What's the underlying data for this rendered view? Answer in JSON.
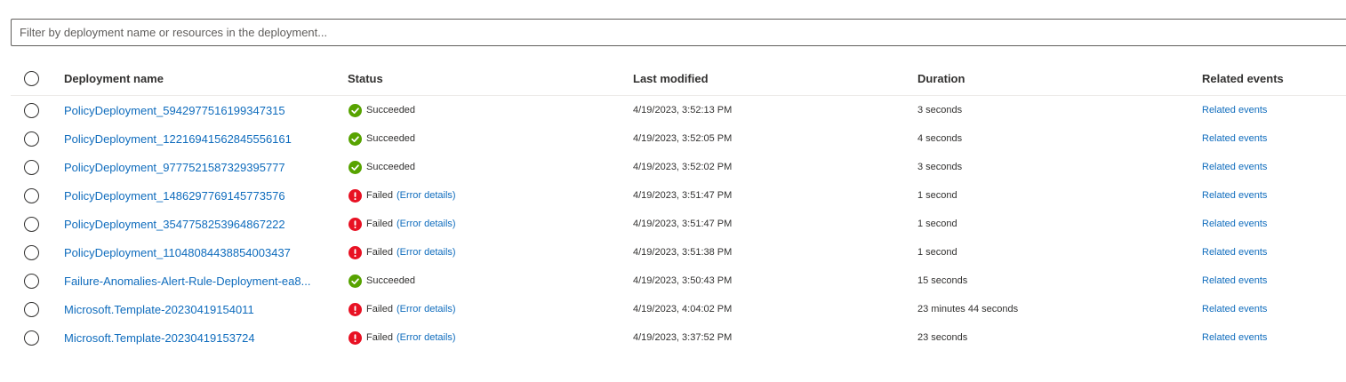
{
  "filter": {
    "placeholder": "Filter by deployment name or resources in the deployment..."
  },
  "table": {
    "columns": {
      "name": "Deployment name",
      "status": "Status",
      "last_modified": "Last modified",
      "duration": "Duration",
      "related": "Related events"
    },
    "rows": [
      {
        "name": "PolicyDeployment_5942977516199347315",
        "status": "Succeeded",
        "status_type": "success",
        "error_link": "",
        "last_modified": "4/19/2023, 3:52:13 PM",
        "duration": "3 seconds",
        "related": "Related events"
      },
      {
        "name": "PolicyDeployment_12216941562845556161",
        "status": "Succeeded",
        "status_type": "success",
        "error_link": "",
        "last_modified": "4/19/2023, 3:52:05 PM",
        "duration": "4 seconds",
        "related": "Related events"
      },
      {
        "name": "PolicyDeployment_9777521587329395777",
        "status": "Succeeded",
        "status_type": "success",
        "error_link": "",
        "last_modified": "4/19/2023, 3:52:02 PM",
        "duration": "3 seconds",
        "related": "Related events"
      },
      {
        "name": "PolicyDeployment_1486297769145773576",
        "status": "Failed",
        "status_type": "failed",
        "error_link": "(Error details)",
        "last_modified": "4/19/2023, 3:51:47 PM",
        "duration": "1 second",
        "related": "Related events"
      },
      {
        "name": "PolicyDeployment_3547758253964867222",
        "status": "Failed",
        "status_type": "failed",
        "error_link": "(Error details)",
        "last_modified": "4/19/2023, 3:51:47 PM",
        "duration": "1 second",
        "related": "Related events"
      },
      {
        "name": "PolicyDeployment_11048084438854003437",
        "status": "Failed",
        "status_type": "failed",
        "error_link": "(Error details)",
        "last_modified": "4/19/2023, 3:51:38 PM",
        "duration": "1 second",
        "related": "Related events"
      },
      {
        "name": "Failure-Anomalies-Alert-Rule-Deployment-ea8...",
        "status": "Succeeded",
        "status_type": "success",
        "error_link": "",
        "last_modified": "4/19/2023, 3:50:43 PM",
        "duration": "15 seconds",
        "related": "Related events"
      },
      {
        "name": "Microsoft.Template-20230419154011",
        "status": "Failed",
        "status_type": "failed",
        "error_link": "(Error details)",
        "last_modified": "4/19/2023, 4:04:02 PM",
        "duration": "23 minutes 44 seconds",
        "related": "Related events"
      },
      {
        "name": "Microsoft.Template-20230419153724",
        "status": "Failed",
        "status_type": "failed",
        "error_link": "(Error details)",
        "last_modified": "4/19/2023, 3:37:52 PM",
        "duration": "23 seconds",
        "related": "Related events"
      }
    ]
  },
  "colors": {
    "link": "#0f6cbd",
    "success": "#57a300",
    "failed": "#e81123",
    "border": "#605e5c"
  },
  "icons": {
    "success": "checkmark-circle-icon",
    "failed": "exclamation-circle-icon",
    "select": "radio-circle-icon"
  }
}
